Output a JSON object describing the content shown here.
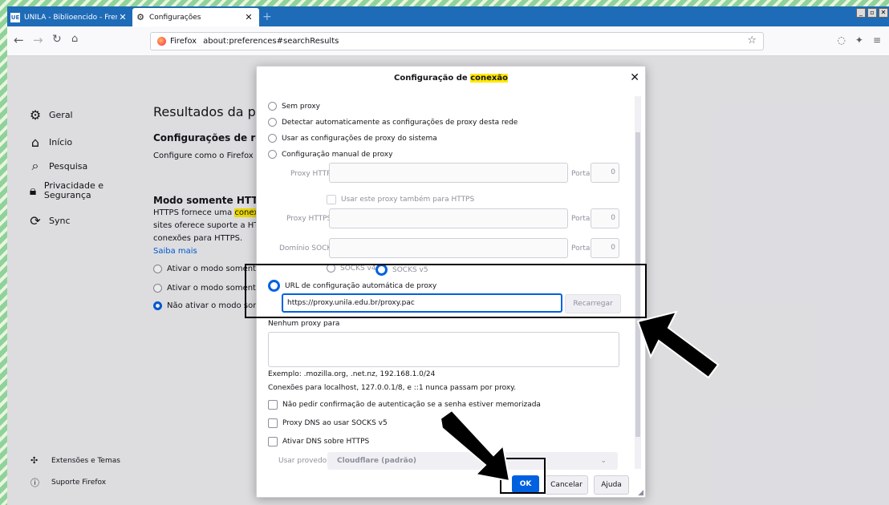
{
  "tabs": [
    {
      "label": "UNILA - Biblioencido - Frente",
      "favicon": "UE"
    },
    {
      "label": "Configurações"
    }
  ],
  "urlbar": {
    "badge": "Firefox",
    "url": "about:preferences#searchResults"
  },
  "sidebar": {
    "items": [
      {
        "label": "Geral",
        "icon": "gear-icon"
      },
      {
        "label": "Início",
        "icon": "home-icon"
      },
      {
        "label": "Pesquisa",
        "icon": "search-icon"
      },
      {
        "label": "Privacidade e Segurança",
        "icon": "lock-icon"
      },
      {
        "label": "Sync",
        "icon": "sync-icon"
      }
    ],
    "bottom": [
      {
        "label": "Extensões e Temas",
        "icon": "puzzle-icon"
      },
      {
        "label": "Suporte Firefox",
        "icon": "help-icon"
      }
    ]
  },
  "main": {
    "results_title": "Resultados da pesqui",
    "net_title": "Configurações de rede",
    "net_text": "Configure como o Firefox se c",
    "https_title": "Modo somente HTTPS",
    "https_text_pre": "HTTPS fornece uma ",
    "https_text_hl": "conexão",
    "https_text_post": " c",
    "https_line2": "sites oferece suporte a HTTPS.",
    "https_line3": "conexões para HTTPS.",
    "learn_more": "Saiba mais",
    "radios": [
      "Ativar o modo somente",
      "Ativar o modo somente H",
      "Não ativar o modo soment"
    ]
  },
  "dialog": {
    "title_pre": "Configuração de ",
    "title_hl": "conexão",
    "options": [
      "Sem proxy",
      "Detectar automaticamente as configurações de proxy desta rede",
      "Usar as configurações de proxy do sistema",
      "Configuração manual de proxy"
    ],
    "http_label": "Proxy HTTP",
    "port_label": "Porta",
    "port_value": "0",
    "also_https": "Usar este proxy também para HTTPS",
    "https_label": "Proxy HTTPS",
    "socks_label": "Domínio SOCKS",
    "socks_v4": "SOCKS v4",
    "socks_v5": "SOCKS v5",
    "pac_label": "URL de configuração automática de proxy",
    "pac_url": "https://proxy.unila.edu.br/proxy.pac",
    "reload": "Recarregar",
    "no_proxy_label": "Nenhum proxy para",
    "example": "Exemplo: .mozilla.org, .net.nz, 192.168.1.0/24",
    "localhost_note": "Conexões para localhost, 127.0.0.1/8, e ::1 nunca passam por proxy.",
    "checks": [
      "Não pedir confirmação de autenticação se a senha estiver memorizada",
      "Proxy DNS ao usar SOCKS v5",
      "Ativar DNS sobre HTTPS"
    ],
    "provider_label": "Usar provedor",
    "provider_value": "Cloudflare (padrão)",
    "ok": "OK",
    "cancel": "Cancelar",
    "help": "Ajuda"
  }
}
